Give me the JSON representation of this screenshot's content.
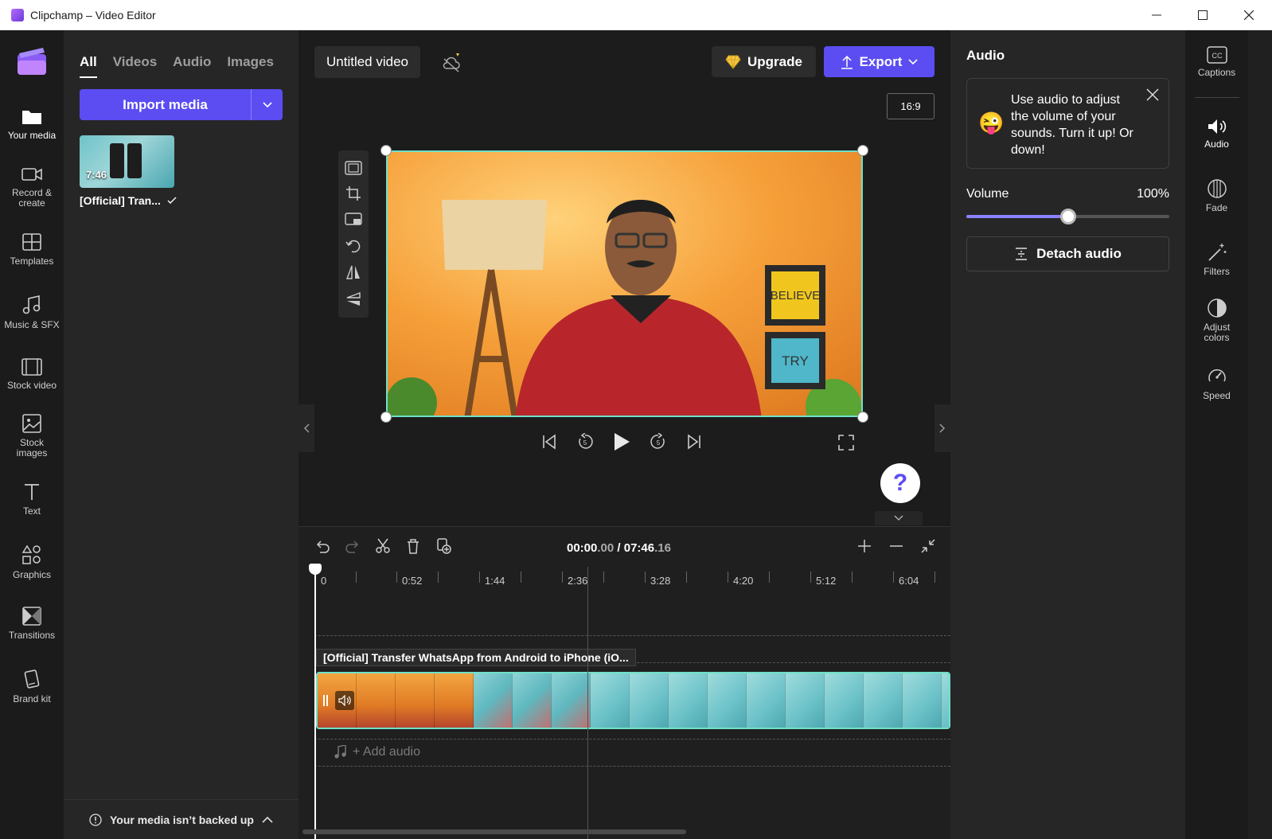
{
  "window": {
    "title": "Clipchamp – Video Editor",
    "minimize": "—",
    "maximize": "☐",
    "close": "✕"
  },
  "left_rail": {
    "items": [
      {
        "label": "Your media",
        "icon": "folder-icon"
      },
      {
        "label": "Record & create",
        "icon": "camera-icon"
      },
      {
        "label": "Templates",
        "icon": "templates-icon"
      },
      {
        "label": "Music & SFX",
        "icon": "music-icon"
      },
      {
        "label": "Stock video",
        "icon": "film-icon"
      },
      {
        "label": "Stock images",
        "icon": "image-icon"
      },
      {
        "label": "Text",
        "icon": "text-icon"
      },
      {
        "label": "Graphics",
        "icon": "shapes-icon"
      },
      {
        "label": "Transitions",
        "icon": "transitions-icon"
      },
      {
        "label": "Brand kit",
        "icon": "brand-kit-icon"
      }
    ]
  },
  "media_panel": {
    "tabs": [
      "All",
      "Videos",
      "Audio",
      "Images"
    ],
    "active_tab": "All",
    "import_label": "Import media",
    "item": {
      "duration": "7:46",
      "label": "[Official] Tran..."
    },
    "backup_text": "Your media isn’t backed up"
  },
  "header": {
    "project_title": "Untitled video",
    "upgrade_label": "Upgrade",
    "export_label": "Export",
    "aspect_ratio": "16:9"
  },
  "preview": {
    "scene_text_1": "BELIEVE",
    "scene_text_2": "TRY"
  },
  "help_label": "?",
  "timeline": {
    "current_time_main": "00:00",
    "current_time_ms": ".00",
    "separator": " / ",
    "total_time_main": "07:46",
    "total_time_ms": ".16",
    "ruler_labels": [
      "0",
      "0:52",
      "1:44",
      "2:36",
      "3:28",
      "4:20",
      "5:12",
      "6:04"
    ],
    "clip_label": "[Official] Transfer WhatsApp from Android to iPhone (iO...",
    "add_audio_label": "+ Add audio"
  },
  "properties": {
    "title": "Audio",
    "tip_text": "Use audio to adjust the volume of your sounds. Turn it up! Or down!",
    "volume_label": "Volume",
    "volume_value": "100%",
    "volume_level": 0.5,
    "detach_label": "Detach audio"
  },
  "right_rail": {
    "items": [
      {
        "label": "Captions",
        "icon": "captions-icon"
      },
      {
        "label": "Audio",
        "icon": "speaker-icon"
      },
      {
        "label": "Fade",
        "icon": "fade-icon"
      },
      {
        "label": "Filters",
        "icon": "magic-wand-icon"
      },
      {
        "label": "Adjust colors",
        "icon": "contrast-icon"
      },
      {
        "label": "Speed",
        "icon": "speedometer-icon"
      }
    ]
  },
  "colors": {
    "accent": "#5b4df2",
    "selection": "#6fe0c8"
  }
}
